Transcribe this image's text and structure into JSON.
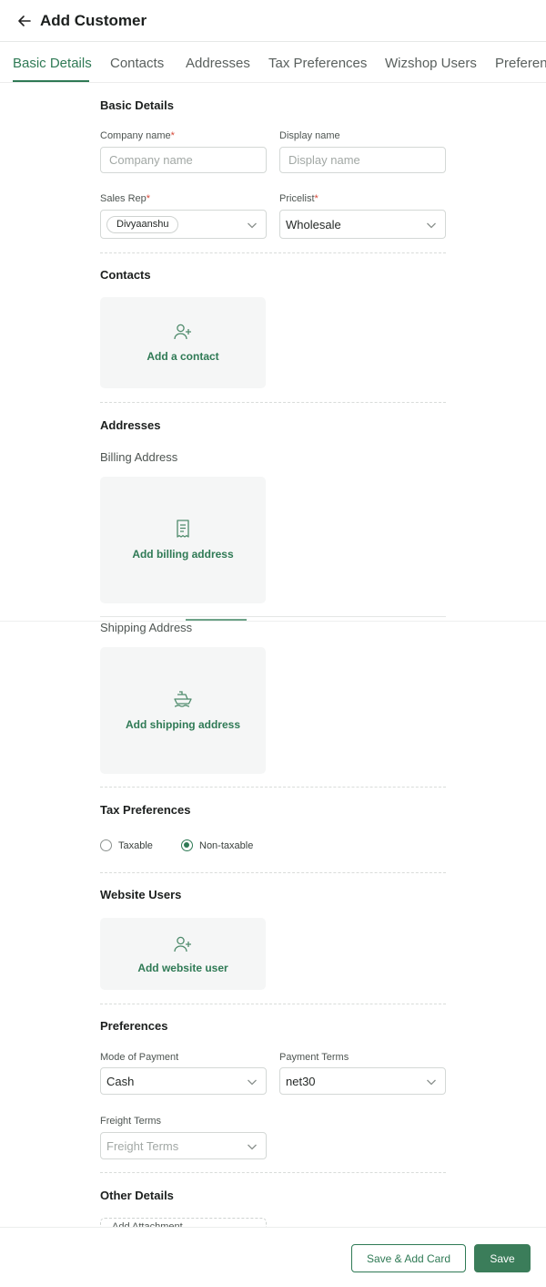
{
  "header": {
    "title": "Add Customer",
    "back_icon": "arrow-left-icon"
  },
  "tabs": [
    {
      "label": "Basic Details",
      "active": true
    },
    {
      "label": "Contacts"
    },
    {
      "label": "Addresses"
    },
    {
      "label": "Tax Preferences"
    },
    {
      "label": "Wizshop Users"
    },
    {
      "label": "Preferen"
    }
  ],
  "basic": {
    "title": "Basic Details",
    "company_label": "Company name",
    "company_placeholder": "Company name",
    "display_label": "Display name",
    "display_placeholder": "Display name",
    "salesrep_label": "Sales Rep",
    "salesrep_value": "Divyaanshu",
    "pricelist_label": "Pricelist",
    "pricelist_value": "Wholesale",
    "required_mark": "*"
  },
  "contacts": {
    "title": "Contacts",
    "add_label": "Add a contact",
    "icon": "user-plus-icon"
  },
  "addresses": {
    "title": "Addresses",
    "billing_title": "Billing Address",
    "billing_add": "Add billing address",
    "billing_icon": "receipt-icon",
    "shipping_title": "Shipping Address",
    "shipping_add": "Add shipping address",
    "shipping_icon": "ship-icon"
  },
  "tax": {
    "title": "Tax Preferences",
    "options": [
      "Taxable",
      "Non-taxable"
    ],
    "selected": "Non-taxable"
  },
  "website_users": {
    "title": "Website Users",
    "add_label": "Add website user",
    "icon": "user-plus-icon"
  },
  "preferences": {
    "title": "Preferences",
    "payment_mode_label": "Mode of Payment",
    "payment_mode_value": "Cash",
    "payment_terms_label": "Payment Terms",
    "payment_terms_value": "net30",
    "freight_label": "Freight Terms",
    "freight_placeholder": "Freight Terms"
  },
  "other": {
    "title": "Other Details",
    "attachment_label": "Add Attachment"
  },
  "footer": {
    "save_add_card": "Save & Add Card",
    "save": "Save"
  },
  "colors": {
    "accent": "#2f7a55",
    "required": "#d64a3a",
    "card_bg": "#f5f6f6"
  }
}
